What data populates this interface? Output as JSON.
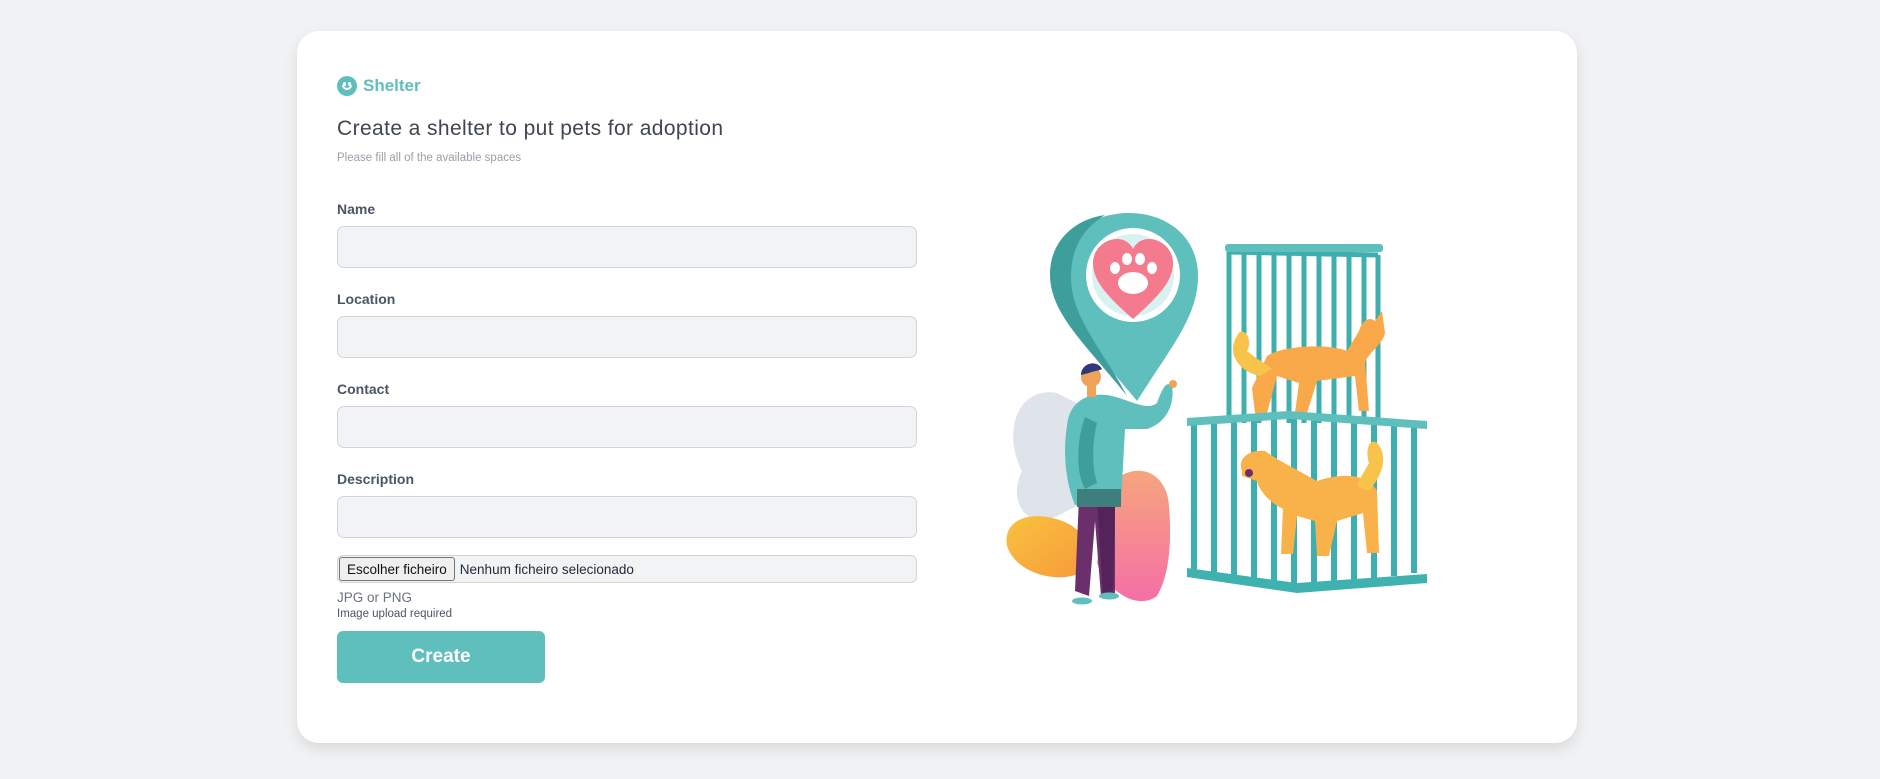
{
  "brand": {
    "name": "Shelter",
    "icon": "smiley-icon",
    "color": "#5ebfbd"
  },
  "header": {
    "title": "Create a shelter to put pets for adoption",
    "subtitle": "Please fill all of the available spaces"
  },
  "form": {
    "fields": [
      {
        "label": "Name",
        "value": ""
      },
      {
        "label": "Location",
        "value": ""
      },
      {
        "label": "Contact",
        "value": ""
      },
      {
        "label": "Description",
        "value": ""
      }
    ],
    "file": {
      "button_label": "Escolher ficheiro",
      "status": "Nenhum ficheiro selecionado",
      "hint": "JPG or PNG",
      "required_note": "Image upload required"
    },
    "submit_label": "Create"
  },
  "illustration": {
    "description_icon": "pet-shelter-illustration"
  }
}
